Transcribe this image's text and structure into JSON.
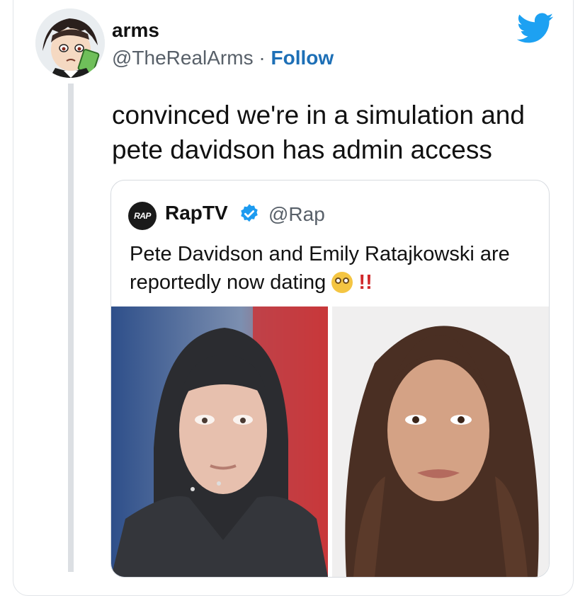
{
  "tweet": {
    "author_name": "arms",
    "author_handle": "@TheRealArms",
    "separator": "·",
    "follow_label": "Follow",
    "text": "convinced we're in a simulation and pete davidson has admin access",
    "icons": {
      "platform": "twitter-bird-icon",
      "avatar": "anime-avatar"
    },
    "colors": {
      "follow": "#1d6fb6",
      "brand": "#1da1f2"
    }
  },
  "quoted_tweet": {
    "avatar_text": "RAP",
    "author_name": "RapTV",
    "author_handle": "@Rap",
    "verified_icon": "verified-badge-icon",
    "text": "Pete Davidson and Emily Ratajkowski are reportedly now dating",
    "emoji": "flushed-face-emoji",
    "exclamation": "!!",
    "photos": [
      {
        "name": "photo-left"
      },
      {
        "name": "photo-right"
      }
    ]
  }
}
